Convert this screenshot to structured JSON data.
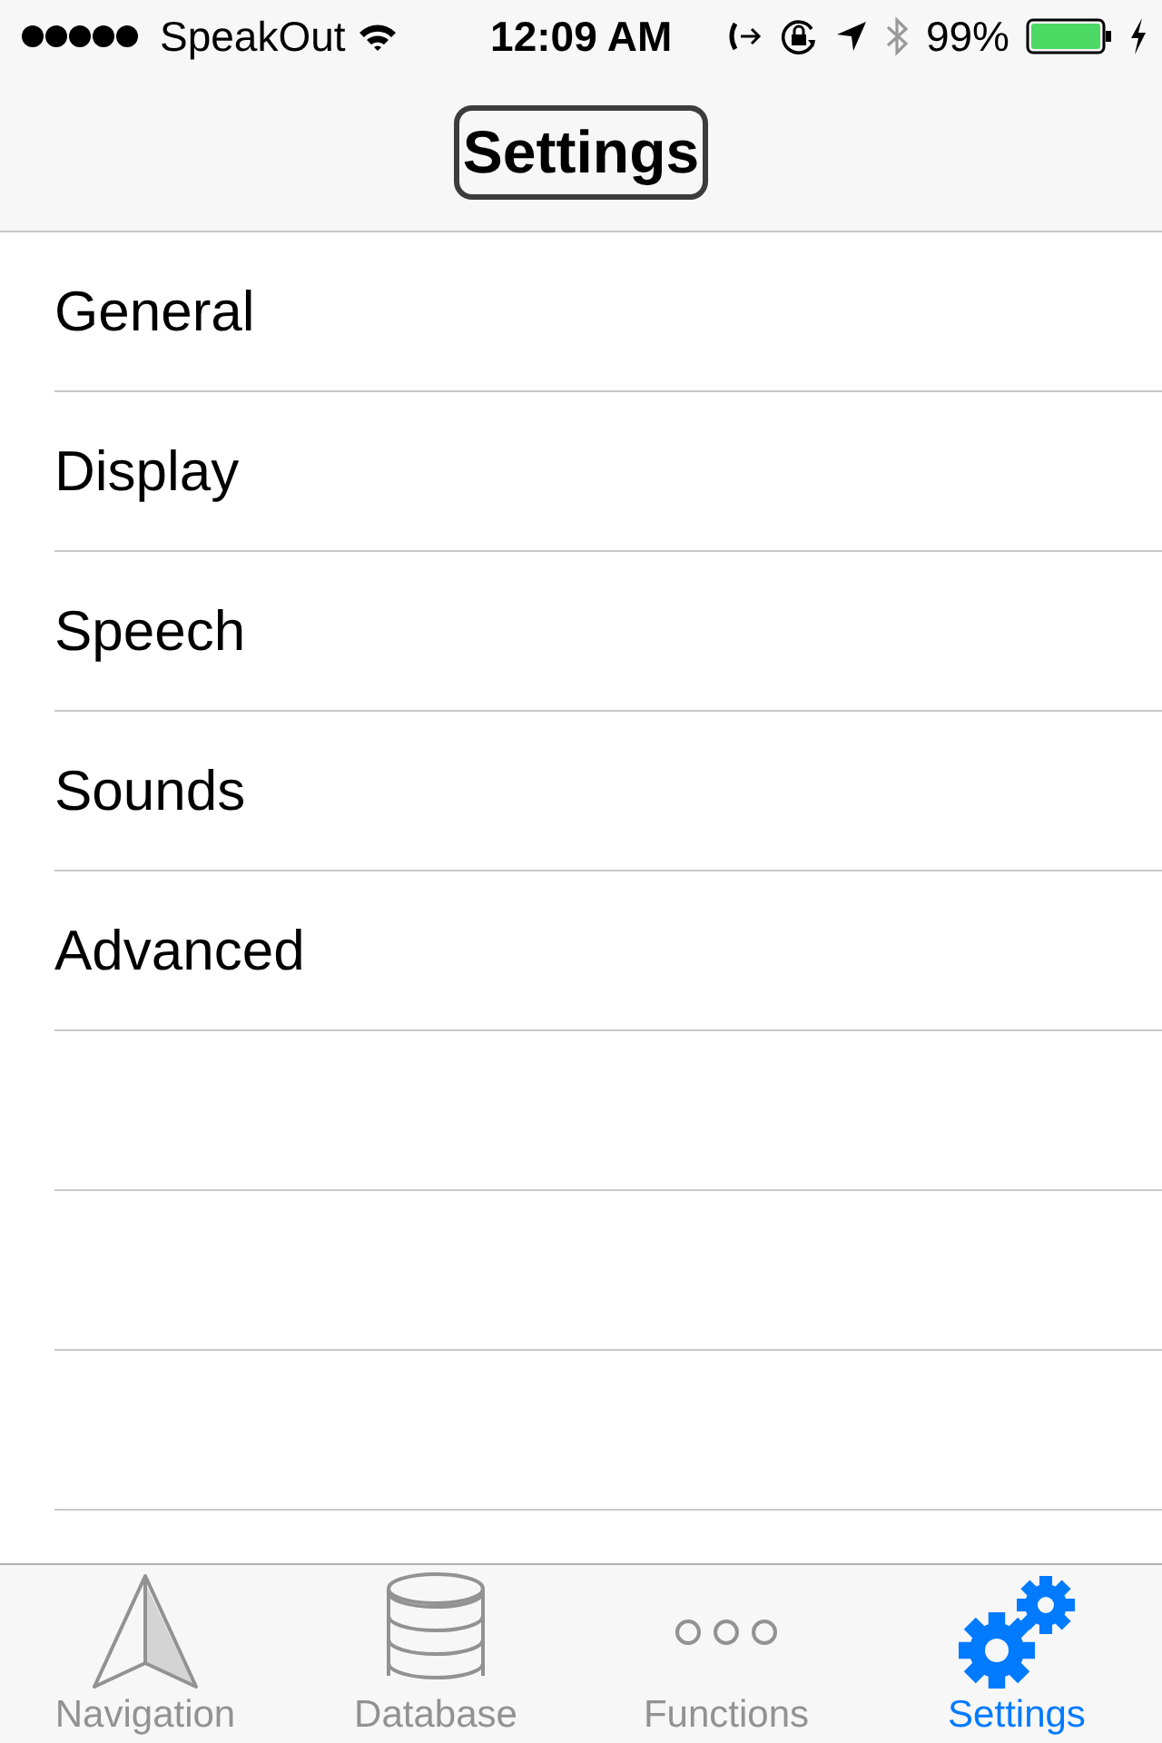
{
  "status_bar": {
    "carrier": "SpeakOut",
    "time": "12:09 AM",
    "battery": "99%"
  },
  "nav_bar": {
    "title": "Settings",
    "focused": true
  },
  "items": [
    {
      "label": "General"
    },
    {
      "label": "Display"
    },
    {
      "label": "Speech"
    },
    {
      "label": "Sounds"
    },
    {
      "label": "Advanced"
    }
  ],
  "tab_bar": [
    {
      "label": "Navigation",
      "selected": false
    },
    {
      "label": "Database",
      "selected": false
    },
    {
      "label": "Functions",
      "selected": false
    },
    {
      "label": "Settings",
      "selected": true
    }
  ]
}
